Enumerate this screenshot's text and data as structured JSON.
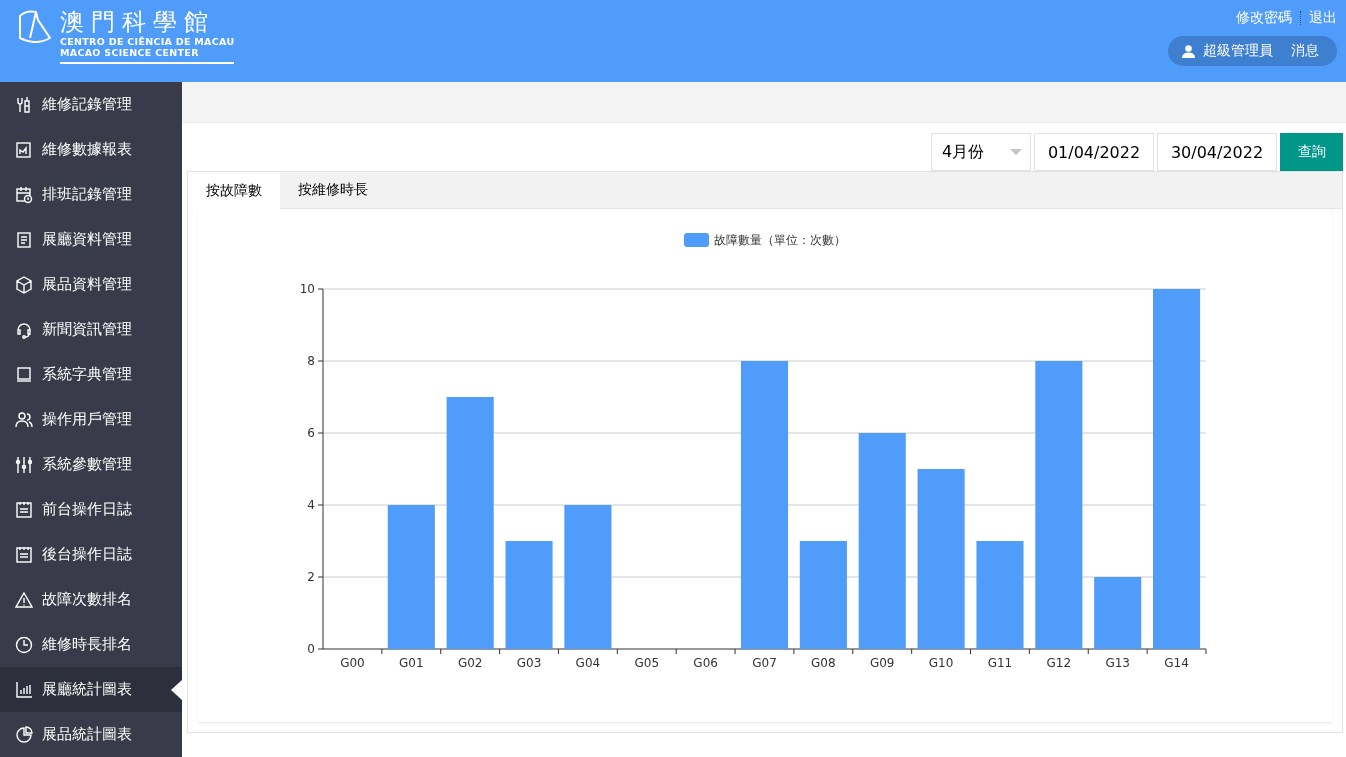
{
  "header": {
    "logo_title": "澳門科學館",
    "logo_subtitle_pt": "CENTRO DE CIÊNCIA DE MACAU",
    "logo_subtitle_en": "MACAO SCIENCE CENTER",
    "links": [
      "修改密碼",
      "退出"
    ],
    "user": "超級管理員",
    "messages": "消息"
  },
  "sidebar": {
    "items": [
      {
        "label": "維修記錄管理",
        "selected": false
      },
      {
        "label": "維修數據報表",
        "selected": false
      },
      {
        "label": "排班記錄管理",
        "selected": false
      },
      {
        "label": "展廳資料管理",
        "selected": false
      },
      {
        "label": "展品資料管理",
        "selected": false
      },
      {
        "label": "新聞資訊管理",
        "selected": false
      },
      {
        "label": "系統字典管理",
        "selected": false
      },
      {
        "label": "操作用戶管理",
        "selected": false
      },
      {
        "label": "系統參數管理",
        "selected": false
      },
      {
        "label": "前台操作日誌",
        "selected": false
      },
      {
        "label": "後台操作日誌",
        "selected": false
      },
      {
        "label": "故障次數排名",
        "selected": false
      },
      {
        "label": "維修時長排名",
        "selected": false
      },
      {
        "label": "展廳統計圖表",
        "selected": true
      },
      {
        "label": "展品統計圖表",
        "selected": false
      }
    ]
  },
  "filter": {
    "month": "4月份",
    "start_date": "01/04/2022",
    "end_date": "30/04/2022",
    "button": "查詢"
  },
  "tabs": [
    {
      "label": "按故障數",
      "selected": true
    },
    {
      "label": "按維修時長",
      "selected": false
    }
  ],
  "chart_data": {
    "type": "bar",
    "categories": [
      "G00",
      "G01",
      "G02",
      "G03",
      "G04",
      "G05",
      "G06",
      "G07",
      "G08",
      "G09",
      "G10",
      "G11",
      "G12",
      "G13",
      "G14"
    ],
    "series": [
      {
        "name": "故障數量（單位：次數）",
        "color": "#4f9cfb",
        "values": [
          0,
          4,
          7,
          3,
          4,
          0,
          0,
          8,
          3,
          6,
          5,
          3,
          8,
          2,
          10
        ]
      }
    ],
    "grid": true,
    "ylim": [
      0,
      10
    ],
    "yticks": [
      0,
      2,
      4,
      6,
      8,
      10
    ]
  }
}
